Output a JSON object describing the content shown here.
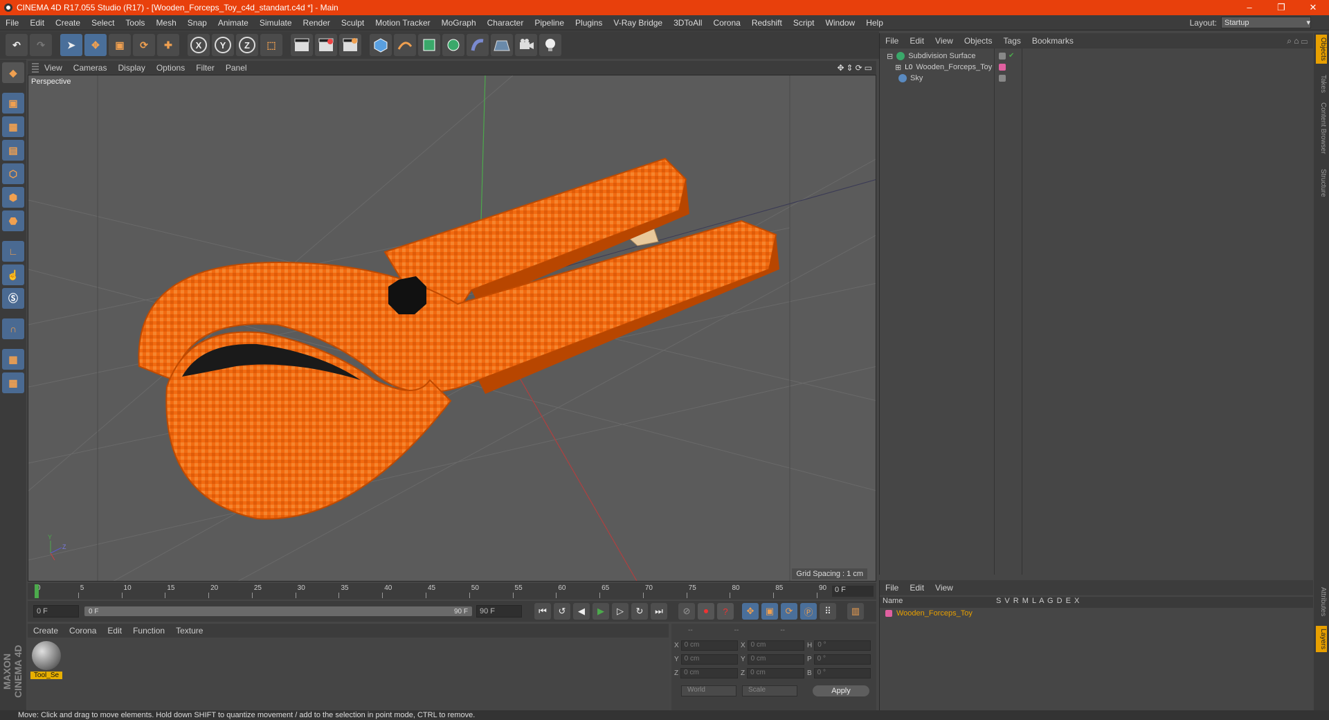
{
  "window": {
    "title": "CINEMA 4D R17.055 Studio (R17) - [Wooden_Forceps_Toy_c4d_standart.c4d *] - Main",
    "min": "–",
    "restore": "❐",
    "close": "✕"
  },
  "menu": [
    "File",
    "Edit",
    "Create",
    "Select",
    "Tools",
    "Mesh",
    "Snap",
    "Animate",
    "Simulate",
    "Render",
    "Sculpt",
    "Motion Tracker",
    "MoGraph",
    "Character",
    "Pipeline",
    "Plugins",
    "V-Ray Bridge",
    "3DToAll",
    "Corona",
    "Redshift",
    "Script",
    "Window",
    "Help"
  ],
  "layout": {
    "label": "Layout:",
    "value": "Startup"
  },
  "toolbar": {
    "undo": "↶",
    "redo": "↷",
    "select": "➤",
    "move": "✥",
    "scale": "▣",
    "rotate": "⟳",
    "last": "✚",
    "x": "X",
    "y": "Y",
    "z": "Z",
    "coord": "⬚"
  },
  "viewport": {
    "menu": [
      "View",
      "Cameras",
      "Display",
      "Options",
      "Filter",
      "Panel"
    ],
    "label": "Perspective",
    "grid_spacing": "Grid Spacing : 1 cm",
    "axis": {
      "y": "Y",
      "z": "Z",
      "x": "X"
    }
  },
  "timeline": {
    "ticks": [
      "0",
      "5",
      "10",
      "15",
      "20",
      "25",
      "30",
      "35",
      "40",
      "45",
      "50",
      "55",
      "60",
      "65",
      "70",
      "75",
      "80",
      "85",
      "90"
    ],
    "end_frame": "0 F",
    "current": "0 F",
    "slider_start": "0 F",
    "slider_end": "90 F",
    "max": "90 F"
  },
  "material_menu": [
    "Create",
    "Corona",
    "Edit",
    "Function",
    "Texture"
  ],
  "material": {
    "label": "Tool_Se"
  },
  "coords": {
    "headers": [
      "--",
      "--",
      "--"
    ],
    "rows": [
      {
        "a": "X",
        "av": "0 cm",
        "b": "X",
        "bv": "0 cm",
        "c": "H",
        "cv": "0 °"
      },
      {
        "a": "Y",
        "av": "0 cm",
        "b": "Y",
        "bv": "0 cm",
        "c": "P",
        "cv": "0 °"
      },
      {
        "a": "Z",
        "av": "0 cm",
        "b": "Z",
        "bv": "0 cm",
        "c": "B",
        "cv": "0 °"
      }
    ],
    "world": "World",
    "scale": "Scale",
    "apply": "Apply"
  },
  "objects_menu": [
    "File",
    "Edit",
    "View",
    "Objects",
    "Tags",
    "Bookmarks"
  ],
  "objects": [
    {
      "name": "Subdivision Surface"
    },
    {
      "name": "Wooden_Forceps_Toy"
    },
    {
      "name": "Sky"
    }
  ],
  "layers_menu": [
    "File",
    "Edit",
    "View"
  ],
  "layers": {
    "columns": "Name",
    "flags": "S  V  R  M  L  A  G  D  E  X",
    "row": "Wooden_Forceps_Toy"
  },
  "right_tabs": [
    "Objects",
    "Takes",
    "Content Browser",
    "Structure",
    "Attributes",
    "Layers"
  ],
  "maxon": "MAXON CINEMA 4D",
  "status": "Move: Click and drag to move elements. Hold down SHIFT to quantize movement / add to the selection in point mode, CTRL to remove.",
  "colors": {
    "accent": "#e8400c",
    "model": "#f26a10",
    "handle": "#e8c89a"
  }
}
